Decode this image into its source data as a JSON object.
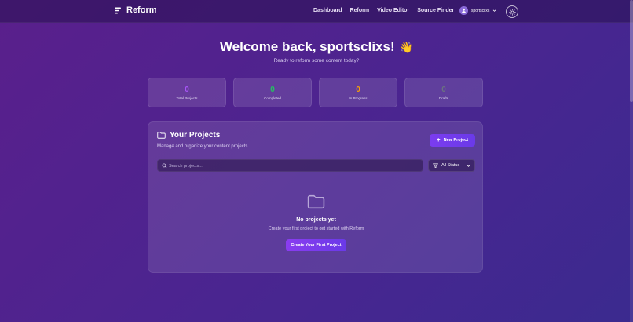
{
  "app": {
    "name": "Reform"
  },
  "nav": {
    "items": [
      "Dashboard",
      "Reform",
      "Video Editor",
      "Source Finder"
    ]
  },
  "user": {
    "name": "sportsclixs"
  },
  "welcome": {
    "title": "Welcome back, sportsclixs!",
    "emoji": "👋",
    "subtitle": "Ready to reform some content today?"
  },
  "stats": [
    {
      "value": "0",
      "label": "Total Projects",
      "color": "#a855f7"
    },
    {
      "value": "0",
      "label": "Completed",
      "color": "#22c55e"
    },
    {
      "value": "0",
      "label": "In Progress",
      "color": "#f59e0b"
    },
    {
      "value": "0",
      "label": "Drafts",
      "color": "#6b7280"
    }
  ],
  "projects": {
    "title": "Your Projects",
    "subtitle": "Manage and organize your content projects",
    "new_button": "New Project",
    "search_placeholder": "Search projects...",
    "filter_selected": "All Status",
    "empty_title": "No projects yet",
    "empty_subtitle": "Create your first project to get started with Reform",
    "create_button": "Create Your First Project"
  }
}
